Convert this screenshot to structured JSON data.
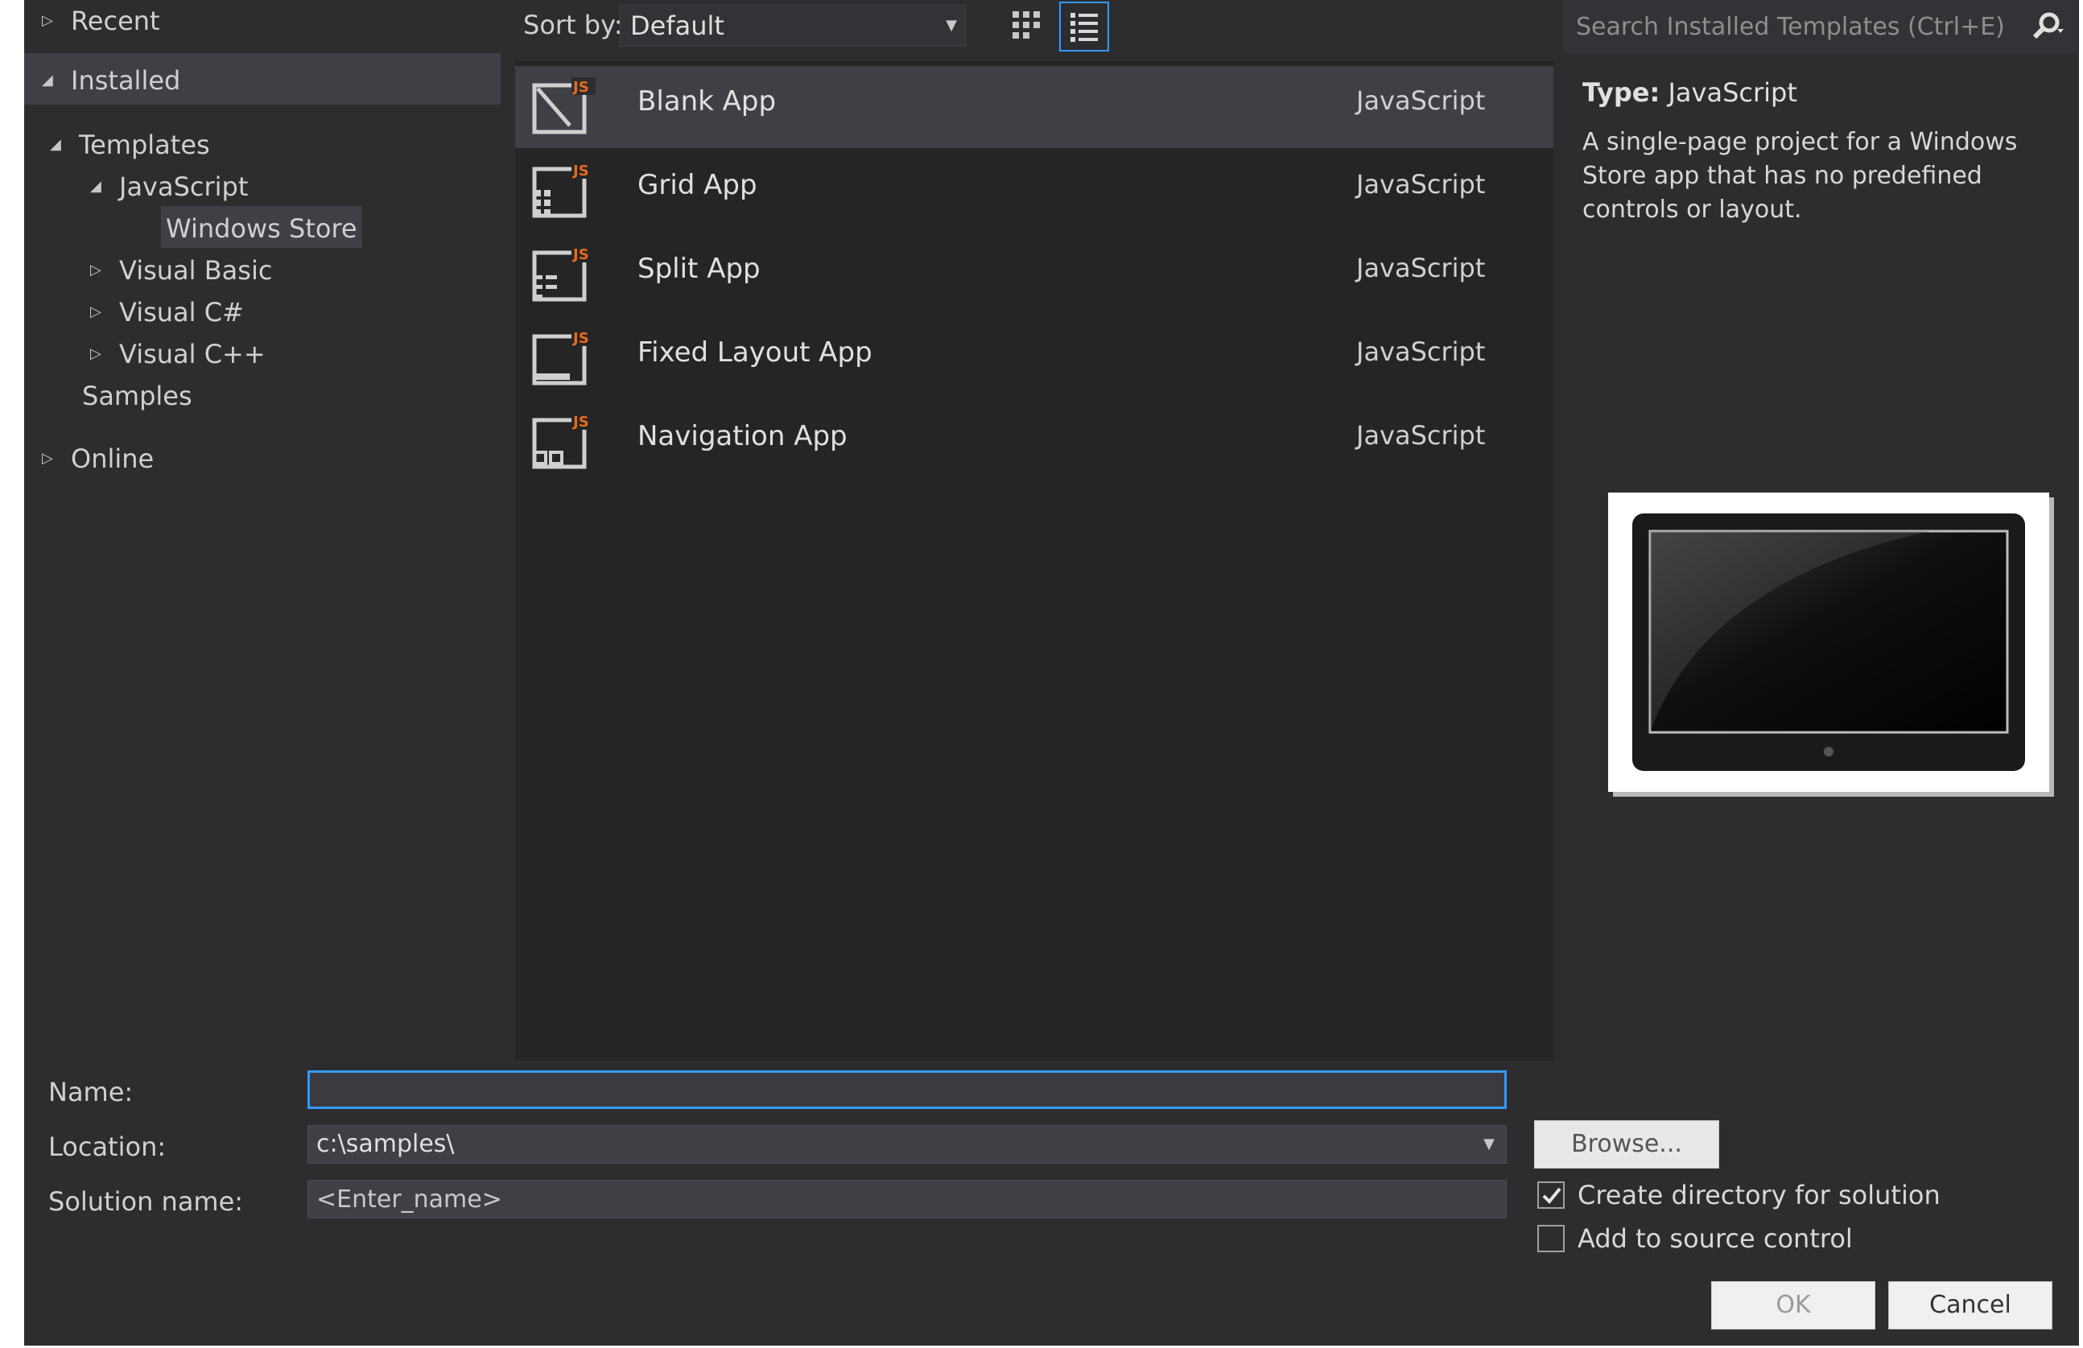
{
  "tree": {
    "recent": "Recent",
    "installed": "Installed",
    "templates": "Templates",
    "javascript": "JavaScript",
    "windows_store": "Windows Store",
    "visual_basic": "Visual Basic",
    "visual_csharp": "Visual C#",
    "visual_cpp": "Visual C++",
    "samples": "Samples",
    "online": "Online"
  },
  "toolbar": {
    "sort_label": "Sort by:",
    "sort_value": "Default",
    "active_view": "list"
  },
  "search": {
    "placeholder": "Search Installed Templates (Ctrl+E)"
  },
  "templates": [
    {
      "name": "Blank App",
      "language": "JavaScript",
      "icon": "blank-app-js-icon",
      "selected": true
    },
    {
      "name": "Grid App",
      "language": "JavaScript",
      "icon": "grid-app-js-icon"
    },
    {
      "name": "Split App",
      "language": "JavaScript",
      "icon": "split-app-js-icon"
    },
    {
      "name": "Fixed Layout App",
      "language": "JavaScript",
      "icon": "fixed-layout-app-js-icon"
    },
    {
      "name": "Navigation App",
      "language": "JavaScript",
      "icon": "navigation-app-js-icon"
    }
  ],
  "details": {
    "type_label": "Type:",
    "type_value": "JavaScript",
    "description": "A single-page project for a Windows Store app that has no predefined controls or layout."
  },
  "form": {
    "name_label": "Name:",
    "name_value": "",
    "location_label": "Location:",
    "location_value": "c:\\samples\\",
    "solution_label": "Solution name:",
    "solution_placeholder": "<Enter_name>",
    "browse_label": "Browse...",
    "create_dir_label": "Create directory for solution",
    "create_dir_checked": true,
    "source_control_label": "Add to source control",
    "source_control_checked": false,
    "ok_label": "OK",
    "cancel_label": "Cancel"
  },
  "colors": {
    "background": "#2d2d30",
    "list_background": "#252526",
    "selection": "#3f3f46",
    "accent": "#3399ff",
    "js_badge": "#e86a1a"
  }
}
